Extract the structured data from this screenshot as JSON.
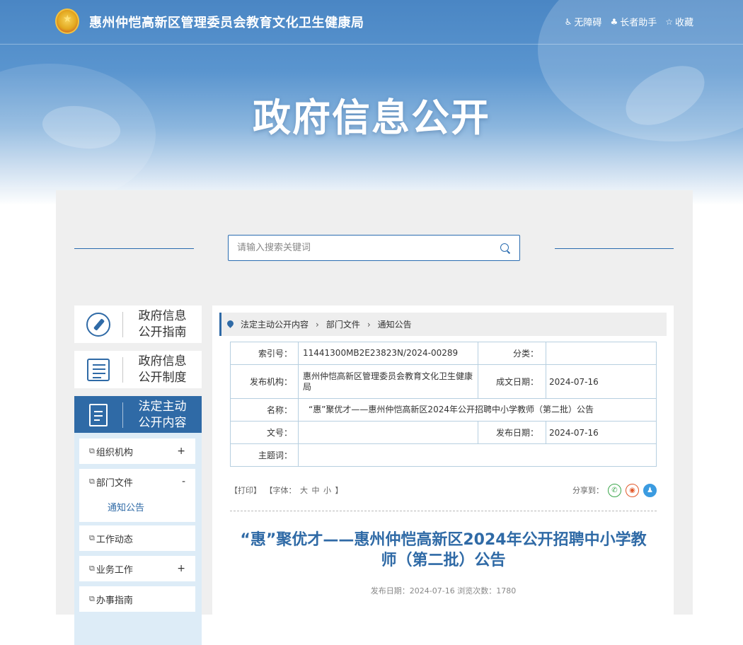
{
  "header": {
    "site_title": "惠州仲恺高新区管理委员会教育文化卫生健康局",
    "links": [
      {
        "label": "无障碍",
        "icon": "accessibility-icon"
      },
      {
        "label": "长者助手",
        "icon": "elder-icon"
      },
      {
        "label": "收藏",
        "icon": "star-icon"
      }
    ],
    "hero_title": "政府信息公开"
  },
  "search": {
    "placeholder": "请输入搜索关键词"
  },
  "sidebar": {
    "cards": [
      {
        "label_line1": "政府信息",
        "label_line2": "公开指南",
        "icon": "compass-icon",
        "active": false
      },
      {
        "label_line1": "政府信息",
        "label_line2": "公开制度",
        "icon": "list-document-icon",
        "active": false
      },
      {
        "label_line1": "法定主动",
        "label_line2": "公开内容",
        "icon": "file-icon",
        "active": true
      }
    ],
    "sub_items": [
      {
        "label": "组织机构",
        "toggle": "+"
      },
      {
        "label": "部门文件",
        "toggle": "-",
        "child": "通知公告"
      },
      {
        "label": "工作动态",
        "toggle": ""
      },
      {
        "label": "业务工作",
        "toggle": "+"
      },
      {
        "label": "办事指南",
        "toggle": ""
      }
    ]
  },
  "breadcrumb": [
    "法定主动公开内容",
    "部门文件",
    "通知公告"
  ],
  "meta": {
    "index_label": "索引号：",
    "index_value": "11441300MB2E23823N/2024-00289",
    "category_label": "分类：",
    "category_value": "",
    "publisher_label": "发布机构：",
    "publisher_value": "惠州仲恺高新区管理委员会教育文化卫生健康局",
    "created_label": "成文日期：",
    "created_value": "2024-07-16",
    "name_label": "名称：",
    "name_value": "“惠”聚优才——惠州仲恺高新区2024年公开招聘中小学教师（第二批）公告",
    "docno_label": "文号：",
    "docno_value": "",
    "published_label": "发布日期：",
    "published_value": "2024-07-16",
    "subject_label": "主题词：",
    "subject_value": ""
  },
  "tools": {
    "print": "【打印】",
    "font_prefix": "【字体：",
    "font_large": "大",
    "font_medium": "中",
    "font_small": "小",
    "font_suffix": "】",
    "share_label": "分享到："
  },
  "article": {
    "title": "“惠”聚优才——惠州仲恺高新区2024年公开招聘中小学教师（第二批）公告",
    "meta_text": "发布日期：2024-07-16   浏览次数：1780"
  },
  "colors": {
    "brand_blue": "#2f6aa6",
    "wechat_green": "#3aa64b",
    "weibo_red": "#e2582a",
    "qq_blue": "#3b9be0"
  }
}
